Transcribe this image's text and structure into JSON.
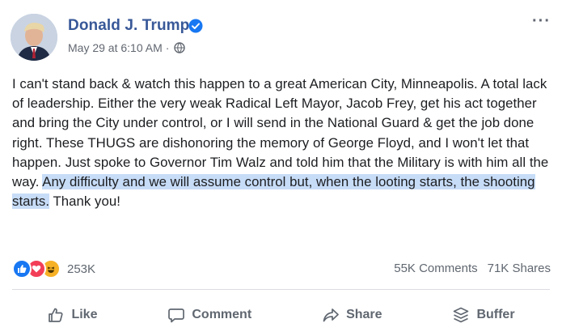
{
  "post": {
    "author": "Donald J. Trump",
    "timestamp": "May 29 at 6:10 AM",
    "separator": "·",
    "text_before": "I can't stand back & watch this happen to a great American City, Minneapolis. A total lack of leadership. Either the very weak Radical Left Mayor, Jacob Frey, get his act together and bring the City under control, or I will send in the National Guard & get the job done right. These THUGS are dishonoring the memory of George Floyd, and I won't let that happen. Just spoke to Governor Tim Walz and told him that the Military is with him all the way. ",
    "text_highlighted": "Any difficulty and we will assume control but, when the looting starts, the shooting starts.",
    "text_after": " Thank you!",
    "more_label": "···"
  },
  "engagement": {
    "reaction_count": "253K",
    "comments": "55K Comments",
    "shares": "71K Shares"
  },
  "actions": {
    "like": "Like",
    "comment": "Comment",
    "share": "Share",
    "buffer": "Buffer"
  },
  "colors": {
    "name": "#385898",
    "highlight": "#c7dcf7",
    "verified": "#1877f2",
    "muted": "#606770"
  }
}
